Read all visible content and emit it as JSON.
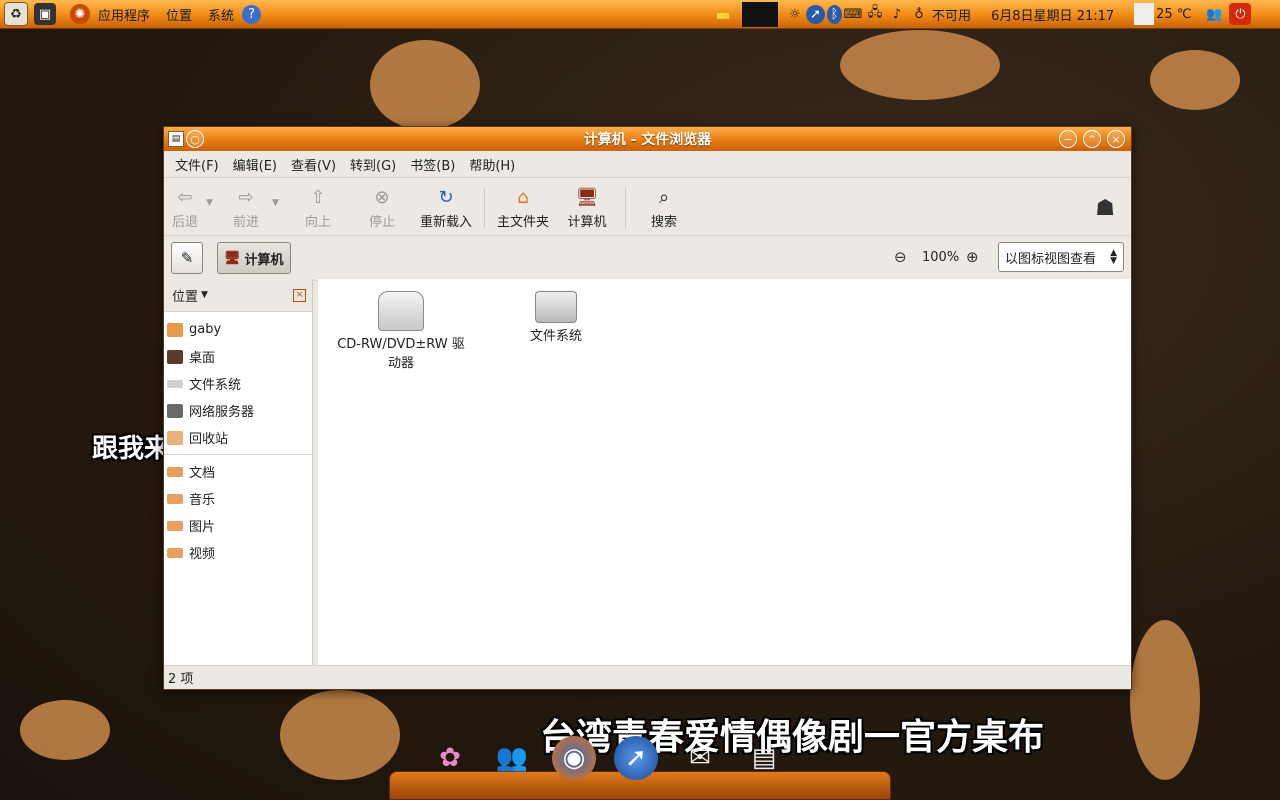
{
  "top_panel": {
    "menus": [
      "应用程序",
      "位置",
      "系统"
    ],
    "network_status": "不可用",
    "datetime": "6月8日星期日 21:17",
    "temperature": "25 ℃"
  },
  "window": {
    "title": "计算机 - 文件浏览器",
    "menus": [
      "文件(F)",
      "编辑(E)",
      "查看(V)",
      "转到(G)",
      "书签(B)",
      "帮助(H)"
    ],
    "toolbar": {
      "back": "后退",
      "forward": "前进",
      "up": "向上",
      "stop": "停止",
      "reload": "重新载入",
      "home": "主文件夹",
      "computer": "计算机",
      "search": "搜索"
    },
    "location": {
      "path_button": "计算机",
      "zoom_level": "100%",
      "view_mode": "以图标视图查看"
    },
    "sidebar": {
      "header": "位置",
      "places": [
        "gaby",
        "桌面",
        "文件系统",
        "网络服务器",
        "回收站"
      ],
      "bookmarks": [
        "文档",
        "音乐",
        "图片",
        "视频"
      ]
    },
    "files": [
      {
        "name": "CD-RW/DVD±RW 驱动器"
      },
      {
        "name": "文件系统"
      }
    ],
    "status": "2 项"
  },
  "wallpaper": {
    "text_left": "跟我来",
    "text_bottom": "台湾青春爱情偶像剧一官方桌布"
  },
  "colors": {
    "panel_orange": "#f08a14",
    "title_orange": "#e5790e",
    "splat": "#c98a4a"
  }
}
